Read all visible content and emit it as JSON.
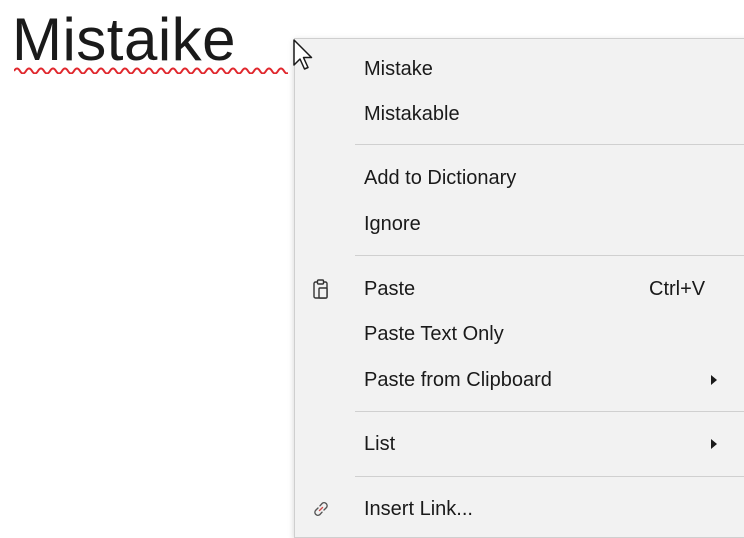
{
  "document": {
    "word": "Mistaike"
  },
  "menu": {
    "suggestions": [
      {
        "label": "Mistake"
      },
      {
        "label": "Mistakable"
      }
    ],
    "spelling": [
      {
        "label": "Add to Dictionary"
      },
      {
        "label": "Ignore"
      }
    ],
    "paste": {
      "label": "Paste",
      "shortcut": "Ctrl+V",
      "icon": "clipboard-icon"
    },
    "paste_text_only": {
      "label": "Paste Text Only"
    },
    "paste_from_clipboard": {
      "label": "Paste from Clipboard",
      "submenu": true
    },
    "list": {
      "label": "List",
      "submenu": true
    },
    "insert_link": {
      "label": "Insert Link...",
      "icon": "link-icon"
    }
  },
  "colors": {
    "menu_background": "#f2f2f2",
    "separator": "#d0d0d0",
    "squiggle": "#e0282e",
    "text": "#1a1a1a"
  }
}
